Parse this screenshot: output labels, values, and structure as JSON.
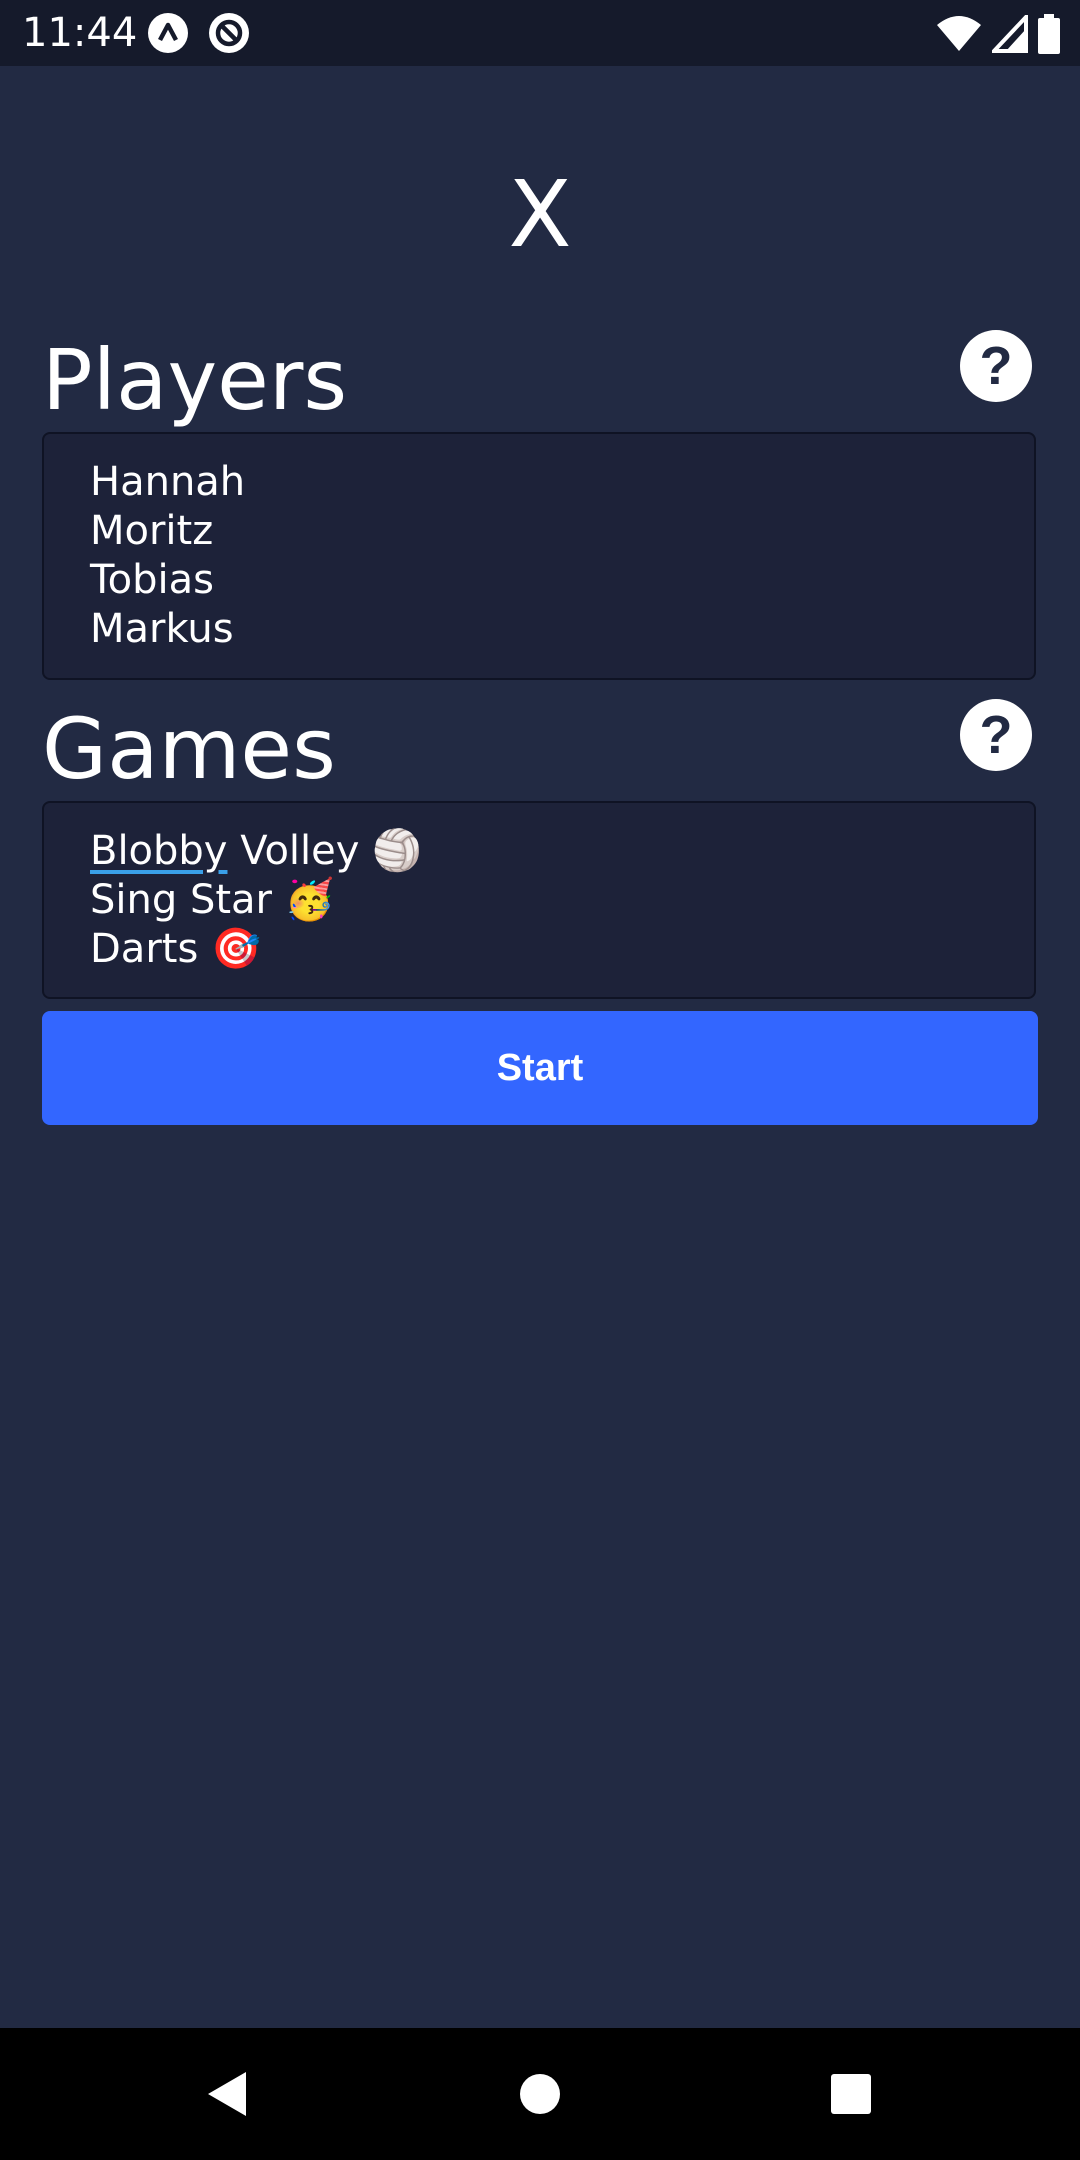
{
  "status_bar": {
    "time": "11:44",
    "left_icons": [
      "expo-icon",
      "react-query-icon"
    ],
    "right_icons": [
      "wifi-icon",
      "cell-signal-icon",
      "battery-icon"
    ]
  },
  "app": {
    "title": "X"
  },
  "players": {
    "title": "Players",
    "items": [
      "Hannah",
      "Moritz",
      "Tobias",
      "Markus"
    ]
  },
  "games": {
    "title": "Games",
    "items": [
      {
        "name_first": "Blobby",
        "name_rest": " Volley ",
        "emoji": "🏐"
      },
      {
        "name_first": "",
        "name_rest": "Sing Star ",
        "emoji": "🥳"
      },
      {
        "name_first": "",
        "name_rest": "Darts ",
        "emoji": "🎯"
      }
    ]
  },
  "start_button": {
    "label": "Start"
  },
  "colors": {
    "background": "#222a43",
    "input_bg": "#1d2239",
    "accent": "#3366ff",
    "status_bar": "#151a2b",
    "nav_bar": "#000000"
  },
  "nav_bar": {
    "icons": [
      "back-icon",
      "home-icon",
      "recents-icon"
    ]
  }
}
